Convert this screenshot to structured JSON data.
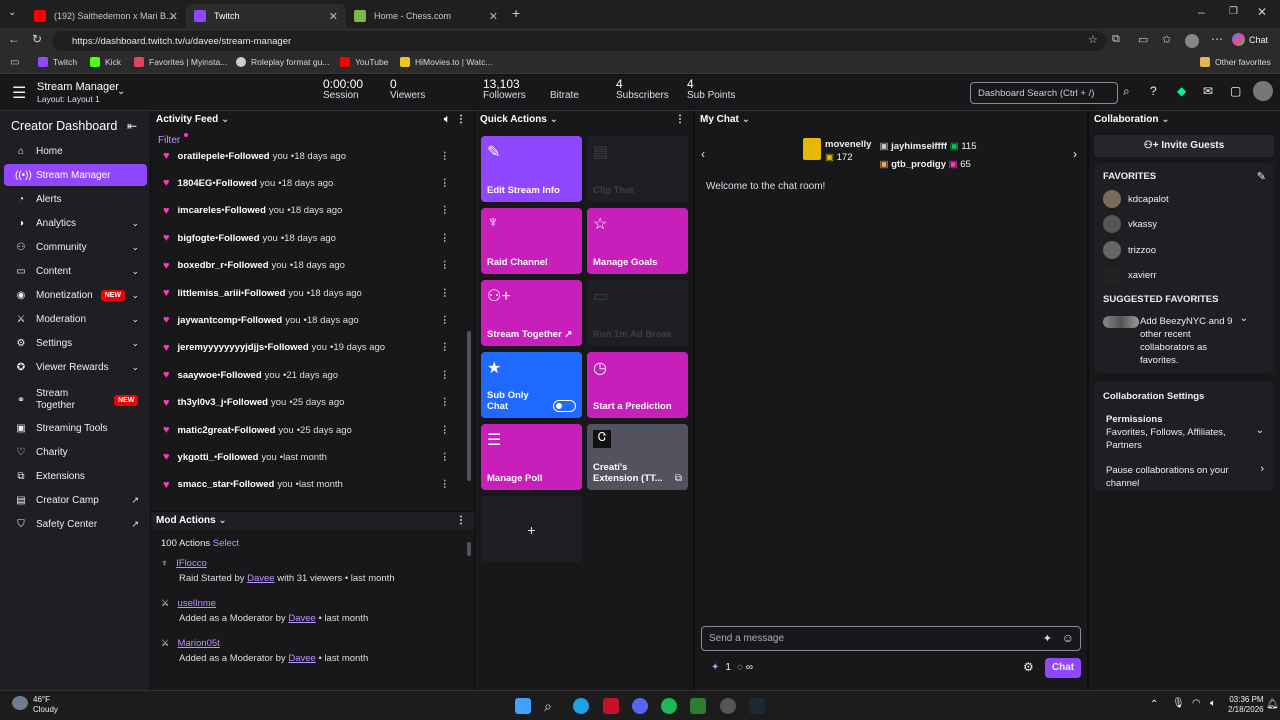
{
  "browser": {
    "tabs": [
      {
        "label": "(192) Saithedemon x Mari B...",
        "active": false
      },
      {
        "label": "Twitch",
        "active": true
      },
      {
        "label": "Home - Chess.com",
        "active": false
      }
    ],
    "url": "https://dashboard.twitch.tv/u/davee/stream-manager",
    "bookmarks": [
      "Twitch",
      "Kick",
      "Favorites | Myinsta...",
      "Roleplay format gu...",
      "YouTube",
      "HiMovies.to | Watc..."
    ],
    "other_favorites": "Other favorites",
    "profile_chat": "Chat"
  },
  "topbar": {
    "title": "Stream Manager",
    "layout": "Layout: Layout 1",
    "stats": [
      {
        "value": "0:00:00",
        "label": "Session"
      },
      {
        "value": "0",
        "label": "Viewers"
      },
      {
        "value": "13,103",
        "label": "Followers"
      },
      {
        "value": "",
        "label": "Bitrate"
      },
      {
        "value": "4",
        "label": "Subscribers"
      },
      {
        "value": "4",
        "label": "Sub Points"
      }
    ],
    "search_placeholder": "Dashboard Search (Ctrl + /)"
  },
  "sidebar": {
    "title": "Creator Dashboard",
    "items": [
      {
        "label": "Home",
        "icon": "home-icon"
      },
      {
        "label": "Stream Manager",
        "icon": "broadcast-icon",
        "active": true
      },
      {
        "label": "Alerts",
        "icon": "bell-icon"
      },
      {
        "label": "Analytics",
        "icon": "chart-icon",
        "chevron": true
      },
      {
        "label": "Community",
        "icon": "community-icon",
        "chevron": true
      },
      {
        "label": "Content",
        "icon": "content-icon",
        "chevron": true
      },
      {
        "label": "Monetization",
        "icon": "money-icon",
        "badge": "NEW",
        "chevron": true
      },
      {
        "label": "Moderation",
        "icon": "sword-icon",
        "chevron": true
      },
      {
        "label": "Settings",
        "icon": "gear-icon",
        "chevron": true
      },
      {
        "label": "Viewer Rewards",
        "icon": "reward-icon",
        "chevron": true
      },
      {
        "label": "Stream Together",
        "icon": "stream-together-icon",
        "badge": "NEW"
      },
      {
        "label": "Streaming Tools",
        "icon": "tools-icon"
      },
      {
        "label": "Charity",
        "icon": "heart-icon"
      },
      {
        "label": "Extensions",
        "icon": "extensions-icon"
      },
      {
        "label": "Creator Camp",
        "icon": "camp-icon",
        "external": true
      },
      {
        "label": "Safety Center",
        "icon": "shield-icon",
        "external": true
      }
    ]
  },
  "activity": {
    "title": "Activity Feed",
    "filter": "Filter",
    "verb": "Followed",
    "you": "you",
    "items": [
      {
        "name": "oratilepele",
        "when": "18 days ago"
      },
      {
        "name": "1804EG",
        "when": "18 days ago"
      },
      {
        "name": "imcareles",
        "when": "18 days ago"
      },
      {
        "name": "bigfogte",
        "when": "18 days ago"
      },
      {
        "name": "boxedbr_r",
        "when": "18 days ago"
      },
      {
        "name": "littlemiss_ariii",
        "when": "18 days ago"
      },
      {
        "name": "jaywantcomp",
        "when": "18 days ago"
      },
      {
        "name": "jeremyyyyyyyyjdjjs",
        "when": "19 days ago"
      },
      {
        "name": "saaywoe",
        "when": "21 days ago"
      },
      {
        "name": "th3yl0v3_j",
        "when": "25 days ago"
      },
      {
        "name": "matic2great",
        "when": "25 days ago"
      },
      {
        "name": "ykgotti_",
        "when": "last month"
      },
      {
        "name": "smacc_star",
        "when": "last month"
      }
    ]
  },
  "mod": {
    "title": "Mod Actions",
    "count": "100 Actions",
    "select": "Select",
    "items": [
      {
        "user": "IFlocco",
        "text1": "Raid Started by",
        "by": "Davee",
        "text2": "with 31 viewers • last month"
      },
      {
        "user": "uselInme",
        "text1": "Added as a Moderator by",
        "by": "Davee",
        "text2": "• last month"
      },
      {
        "user": "Marion05t",
        "text1": "Added as a Moderator by",
        "by": "Davee",
        "text2": "• last month"
      }
    ]
  },
  "quick": {
    "title": "Quick Actions",
    "tiles": [
      {
        "label": "Edit Stream Info",
        "icon": "pencil-icon",
        "color": "#9147ff"
      },
      {
        "label": "Clip That",
        "icon": "clip-icon",
        "disabled": true
      },
      {
        "label": "Raid Channel",
        "icon": "raid-icon",
        "color": "#c81fba"
      },
      {
        "label": "Manage Goals",
        "icon": "star-icon",
        "color": "#c81fba"
      },
      {
        "label": "Stream Together ↗",
        "icon": "add-user-icon",
        "color": "#c81fba"
      },
      {
        "label": "Run 1m Ad Break",
        "icon": "ad-icon",
        "disabled": true
      },
      {
        "label": "Sub Only Chat",
        "icon": "star-icon",
        "color": "#1f69ff",
        "toggle": true
      },
      {
        "label": "Start a Prediction",
        "icon": "prediction-icon",
        "color": "#c81fba"
      },
      {
        "label": "Manage Poll",
        "icon": "poll-icon",
        "color": "#c81fba"
      },
      {
        "label": "Creati's Extension (TT...",
        "icon": "extension-icon",
        "color": "#53535f"
      }
    ],
    "add": "+"
  },
  "chat": {
    "title": "My Chat",
    "leaders": [
      {
        "name": "movenelly",
        "value": "172"
      },
      {
        "name": "jayhimselffff",
        "value": "115"
      },
      {
        "name": "gtb_prodigy",
        "value": "65"
      }
    ],
    "welcome": "Welcome to the chat room!",
    "placeholder": "Send a message",
    "points": "1",
    "infinity": "∞",
    "send": "Chat"
  },
  "collab": {
    "title": "Collaboration",
    "invite": "Invite Guests",
    "favorites_title": "FAVORITES",
    "favorites": [
      "kdcapalot",
      "vkassy",
      "trizzoo",
      "xavierr"
    ],
    "suggested_title": "SUGGESTED FAVORITES",
    "suggested_text": "Add BeezyNYC and 9 other recent collaborators as favorites.",
    "settings_title": "Collaboration Settings",
    "permissions_title": "Permissions",
    "permissions_value": "Favorites, Follows, Affiliates, Partners",
    "pause": "Pause collaborations on your channel"
  },
  "taskbar": {
    "temp": "46°F",
    "weather": "Cloudy",
    "time": "03:36 PM",
    "date": "2/18/2026"
  }
}
